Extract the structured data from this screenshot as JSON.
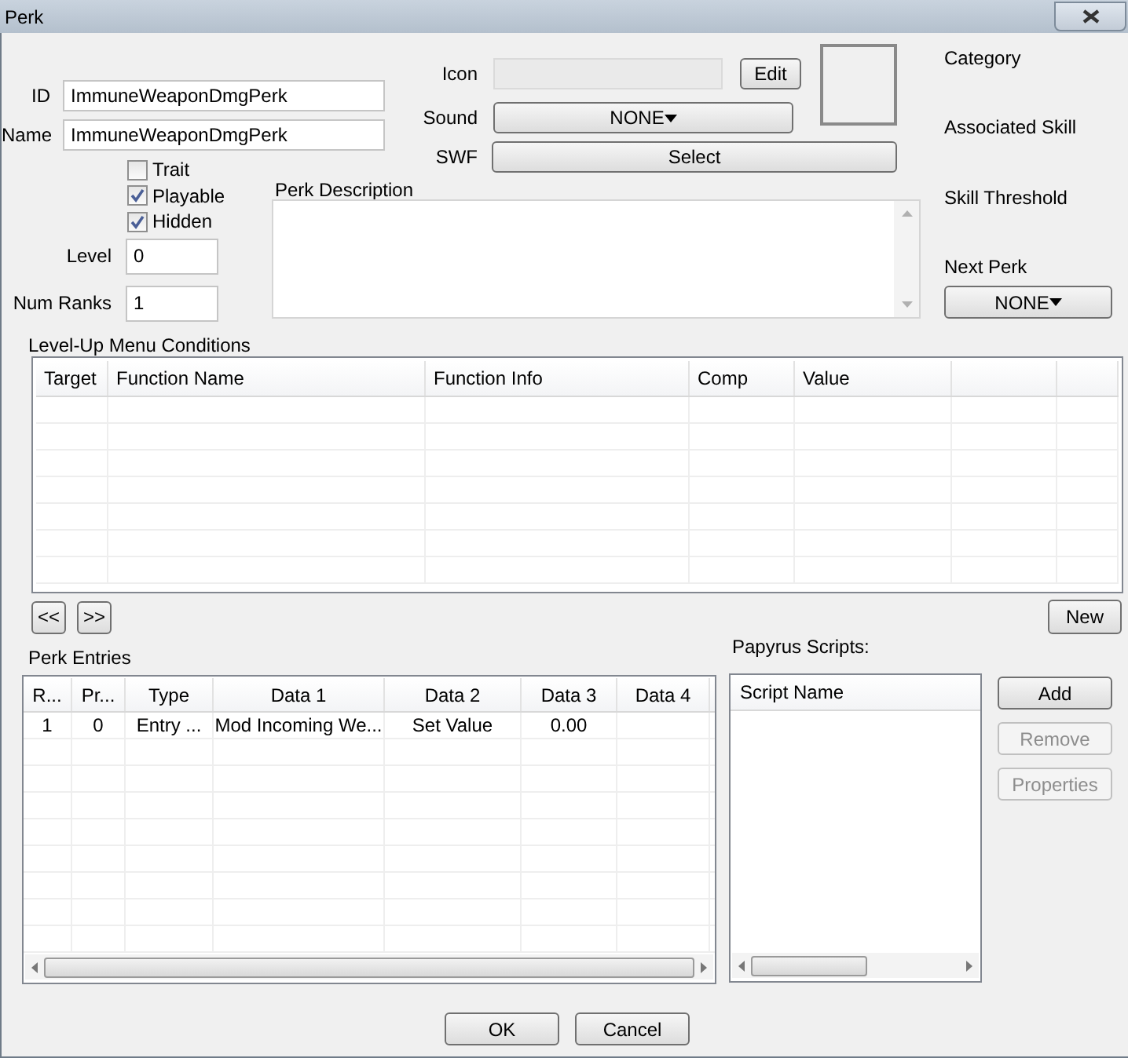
{
  "window": {
    "title": "Perk"
  },
  "fields": [
    {
      "label": "ID",
      "value": "ImmuneWeaponDmgPerk"
    },
    {
      "label": "Name",
      "value": "ImmuneWeaponDmgPerk"
    }
  ],
  "checkboxes": [
    {
      "label": "Trait",
      "checked": false
    },
    {
      "label": "Playable",
      "checked": true
    },
    {
      "label": "Hidden",
      "checked": true
    }
  ],
  "level": {
    "label": "Level",
    "value": "0"
  },
  "num_ranks": {
    "label": "Num Ranks",
    "value": "1"
  },
  "icon": {
    "label": "Icon",
    "button": "Edit"
  },
  "sound": {
    "label": "Sound",
    "value": "NONE"
  },
  "swf": {
    "label": "SWF",
    "button": "Select"
  },
  "perk_description": {
    "label": "Perk Description"
  },
  "right_labels": [
    "Category",
    "Associated Skill",
    "Skill Threshold"
  ],
  "next_perk": {
    "label": "Next Perk",
    "value": "NONE"
  },
  "conditions": {
    "label": "Level-Up Menu Conditions",
    "columns": [
      "Target",
      "Function Name",
      "Function Info",
      "Comp",
      "Value"
    ],
    "nav_buttons": [
      "<<",
      ">>"
    ],
    "new_button": "New"
  },
  "perk_entries": {
    "label": "Perk Entries",
    "columns": [
      "R...",
      "Pr...",
      "Type",
      "Data 1",
      "Data 2",
      "Data 3",
      "Data 4"
    ],
    "rows": [
      [
        "1",
        "0",
        "Entry ...",
        "Mod Incoming We...",
        "Set Value",
        "0.00"
      ]
    ]
  },
  "papyrus": {
    "label": "Papyrus Scripts:",
    "column": "Script Name",
    "buttons": [
      {
        "label": "Add",
        "disabled": false
      },
      {
        "label": "Remove",
        "disabled": true
      },
      {
        "label": "Properties",
        "disabled": true
      }
    ]
  },
  "dialog_buttons": [
    "OK",
    "Cancel"
  ]
}
